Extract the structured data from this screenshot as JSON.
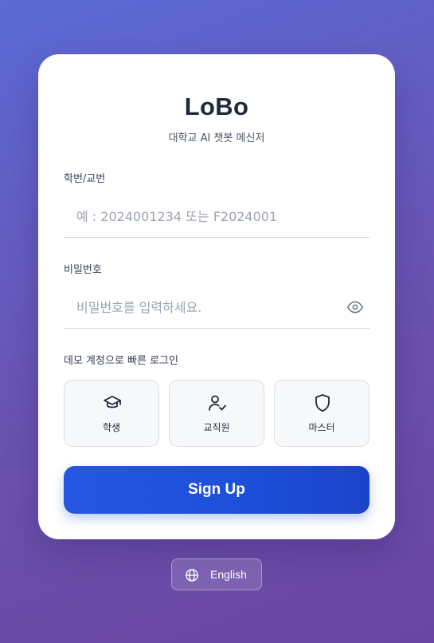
{
  "app": {
    "title": "LoBo",
    "subtitle": "대학교 AI 챗봇 메신저"
  },
  "form": {
    "id_label": "학번/교번",
    "id_placeholder": "예 : 2024001234 또는 F2024001",
    "id_value": "",
    "password_label": "비밀번호",
    "password_placeholder": "비밀번호를 입력하세요.",
    "password_value": ""
  },
  "demo": {
    "label": "데모 계정으로 빠른 로그인",
    "buttons": [
      {
        "label": "학생",
        "icon": "graduation-cap-icon"
      },
      {
        "label": "교직원",
        "icon": "user-check-icon"
      },
      {
        "label": "마스터",
        "icon": "shield-icon"
      }
    ]
  },
  "actions": {
    "signup_label": "Sign Up"
  },
  "language": {
    "label": "English",
    "icon": "globe-icon"
  },
  "colors": {
    "primary": "#1d4fd9",
    "background_start": "#5b6ad6",
    "background_end": "#6a46a0"
  }
}
